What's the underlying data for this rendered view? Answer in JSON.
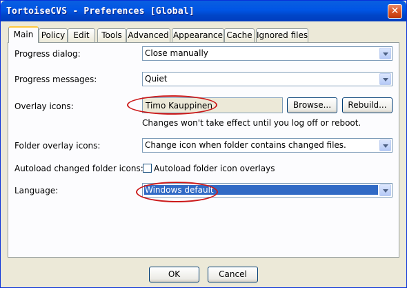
{
  "window": {
    "title": "TortoiseCVS - Preferences [Global]",
    "close_label": "✕"
  },
  "tabs": [
    "Main",
    "Policy",
    "Edit",
    "Tools",
    "Advanced",
    "Appearance",
    "Cache",
    "Ignored files"
  ],
  "active_tab": "Main",
  "main": {
    "progress_dialog": {
      "label": "Progress dialog:",
      "value": "Close manually"
    },
    "progress_messages": {
      "label": "Progress messages:",
      "value": "Quiet"
    },
    "overlay_icons": {
      "label": "Overlay icons:",
      "value": "Timo Kauppinen",
      "browse_label": "Browse...",
      "rebuild_label": "Rebuild...",
      "note": "Changes won't take effect until you log off or reboot."
    },
    "folder_overlay_icons": {
      "label": "Folder overlay icons:",
      "value": "Change icon when folder contains changed files."
    },
    "autoload": {
      "label": "Autoload changed folder icons:",
      "checkbox_label": "Autoload folder icon overlays",
      "checked": false
    },
    "language": {
      "label": "Language:",
      "value": "Windows default"
    }
  },
  "footer": {
    "ok_label": "OK",
    "cancel_label": "Cancel"
  },
  "colors": {
    "titlebar": "#0055e5",
    "highlight": "#316ac5",
    "annotation": "#cc1a1a"
  }
}
